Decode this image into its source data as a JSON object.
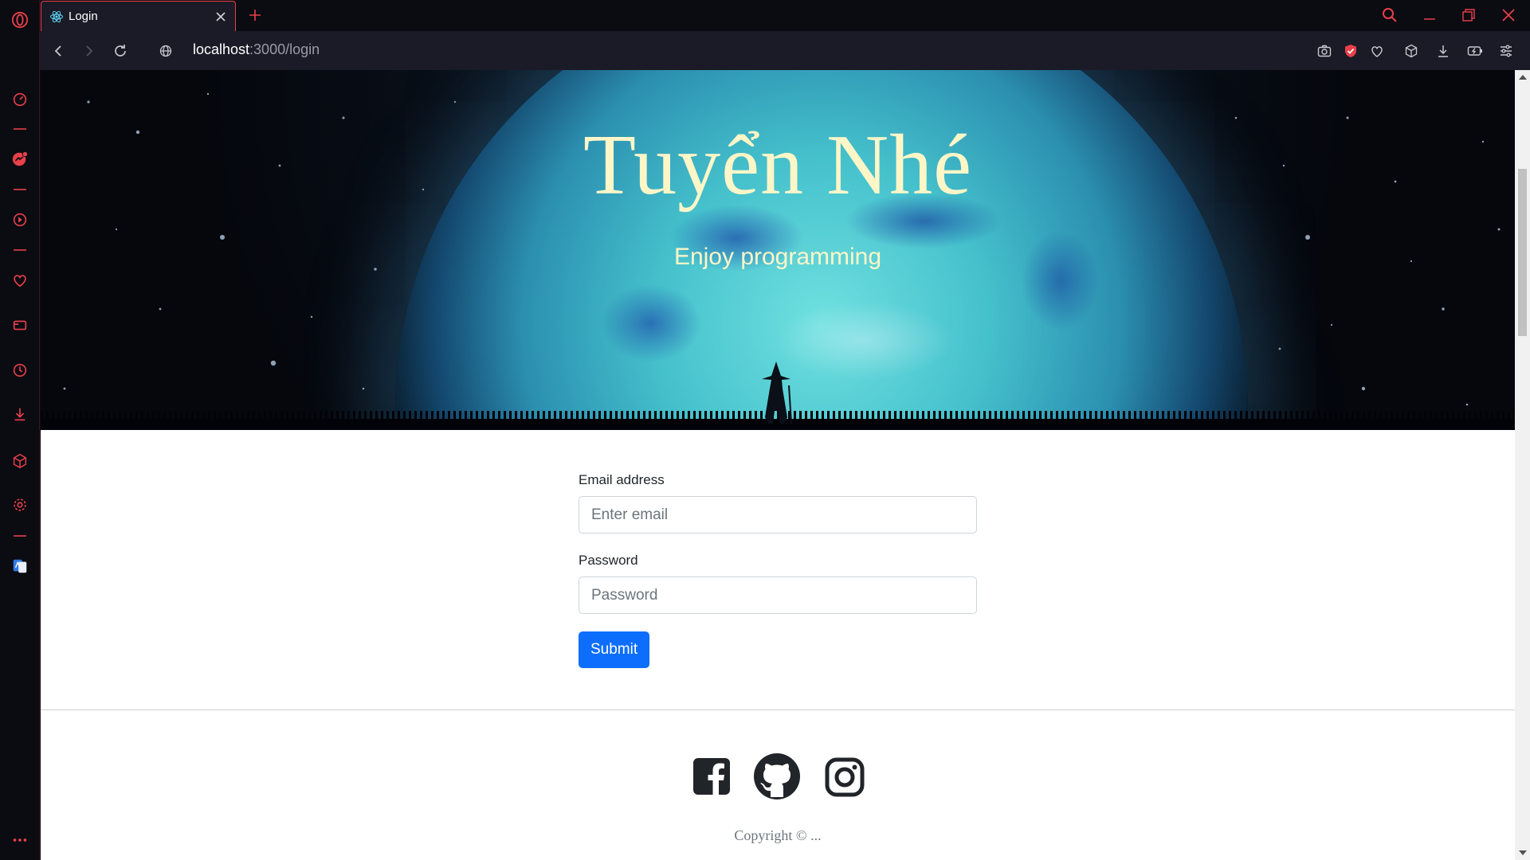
{
  "browser": {
    "tab": {
      "title": "Login"
    },
    "address": {
      "host": "localhost",
      "path": ":3000/login"
    }
  },
  "hero": {
    "title": "Tuyển Nhé",
    "subtitle": "Enjoy programming"
  },
  "login_form": {
    "email_label": "Email address",
    "email_placeholder": "Enter email",
    "email_value": "",
    "password_label": "Password",
    "password_placeholder": "Password",
    "password_value": "",
    "submit_label": "Submit"
  },
  "footer": {
    "social": [
      "facebook-icon",
      "github-icon",
      "instagram-icon"
    ],
    "copyright": "Copyright © ..."
  },
  "colors": {
    "accent": "#e8404a",
    "primary_button": "#0d6efd",
    "hero_text": "#fff6c8"
  }
}
